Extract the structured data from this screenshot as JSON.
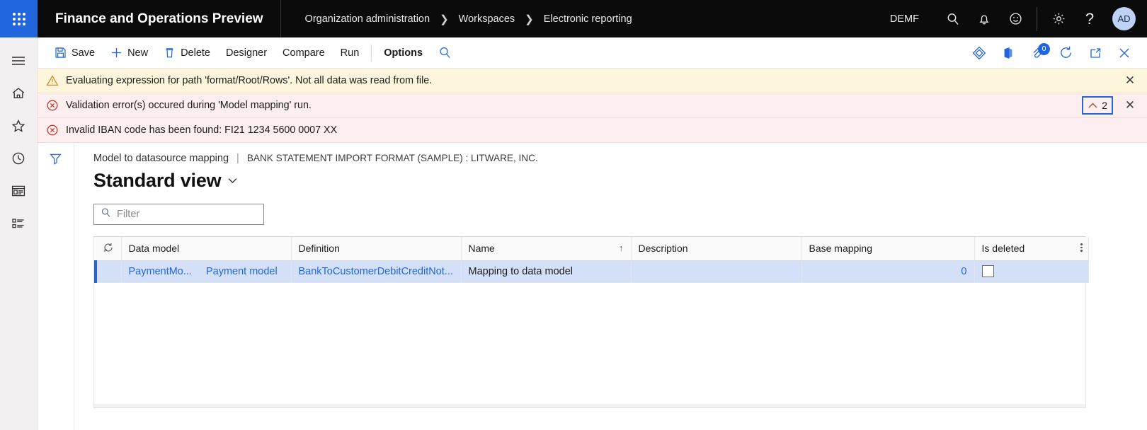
{
  "topbar": {
    "waffle_name": "app-launcher",
    "app_title": "Finance and Operations Preview",
    "breadcrumb": [
      "Organization administration",
      "Workspaces",
      "Electronic reporting"
    ],
    "company": "DEMF",
    "avatar_initials": "AD",
    "icons": [
      "search-icon",
      "notifications-bell-icon",
      "feedback-smiley-icon",
      "settings-gear-icon",
      "help-question-icon"
    ]
  },
  "rail": {
    "items": [
      "hamburger-menu-icon",
      "home-icon",
      "favorites-star-icon",
      "recent-clock-icon",
      "workspaces-icon",
      "modules-list-icon"
    ]
  },
  "actionbar": {
    "save": "Save",
    "new": "New",
    "delete": "Delete",
    "designer": "Designer",
    "compare": "Compare",
    "run": "Run",
    "options": "Options",
    "search_icon": "search-icon",
    "right_icons": [
      "share-diamond-icon",
      "office-app-icon",
      "attachments-icon",
      "refresh-circle-icon",
      "popout-icon",
      "close-icon"
    ],
    "attachment_badge": "0"
  },
  "messages": {
    "warning": {
      "icon": "warning-triangle-icon",
      "text": "Evaluating expression for path 'format/Root/Rows'.   Not all data was read from file."
    },
    "error_1": {
      "icon": "error-circle-icon",
      "text": "Validation error(s) occured during 'Model mapping' run.",
      "collapse_count": "2",
      "collapse_icon": "chevron-up-icon"
    },
    "error_2": {
      "icon": "error-circle-icon",
      "text": "Invalid IBAN code has been found: FI21 1234 5600 0007 XX"
    },
    "close_label": "✕"
  },
  "page": {
    "filter_rail_icon": "filter-funnel-icon",
    "caption_primary": "Model to datasource mapping",
    "caption_separator": "|",
    "caption_secondary": "BANK STATEMENT IMPORT FORMAT (SAMPLE) : LITWARE, INC.",
    "view_name": "Standard view",
    "view_chevron": "chevron-down-icon"
  },
  "filter": {
    "icon": "search-icon",
    "placeholder": "Filter",
    "value": ""
  },
  "grid": {
    "refresh_icon": "refresh-icon",
    "columns": [
      {
        "label": "Data model",
        "sorted": false
      },
      {
        "label": "Definition",
        "sorted": false
      },
      {
        "label": "Name",
        "sorted": true,
        "sort_arrow": "↑"
      },
      {
        "label": "Description",
        "sorted": false
      },
      {
        "label": "Base mapping",
        "sorted": false
      },
      {
        "label": "Is deleted",
        "sorted": false
      }
    ],
    "header_menu_icon": "column-options-icon",
    "rows": [
      {
        "data_model_code": "PaymentMo...",
        "data_model_name": "Payment model",
        "definition": "BankToCustomerDebitCreditNot...",
        "name": "Mapping to data model",
        "description": "",
        "base_mapping": "0",
        "is_deleted": false,
        "selected": true
      }
    ]
  }
}
